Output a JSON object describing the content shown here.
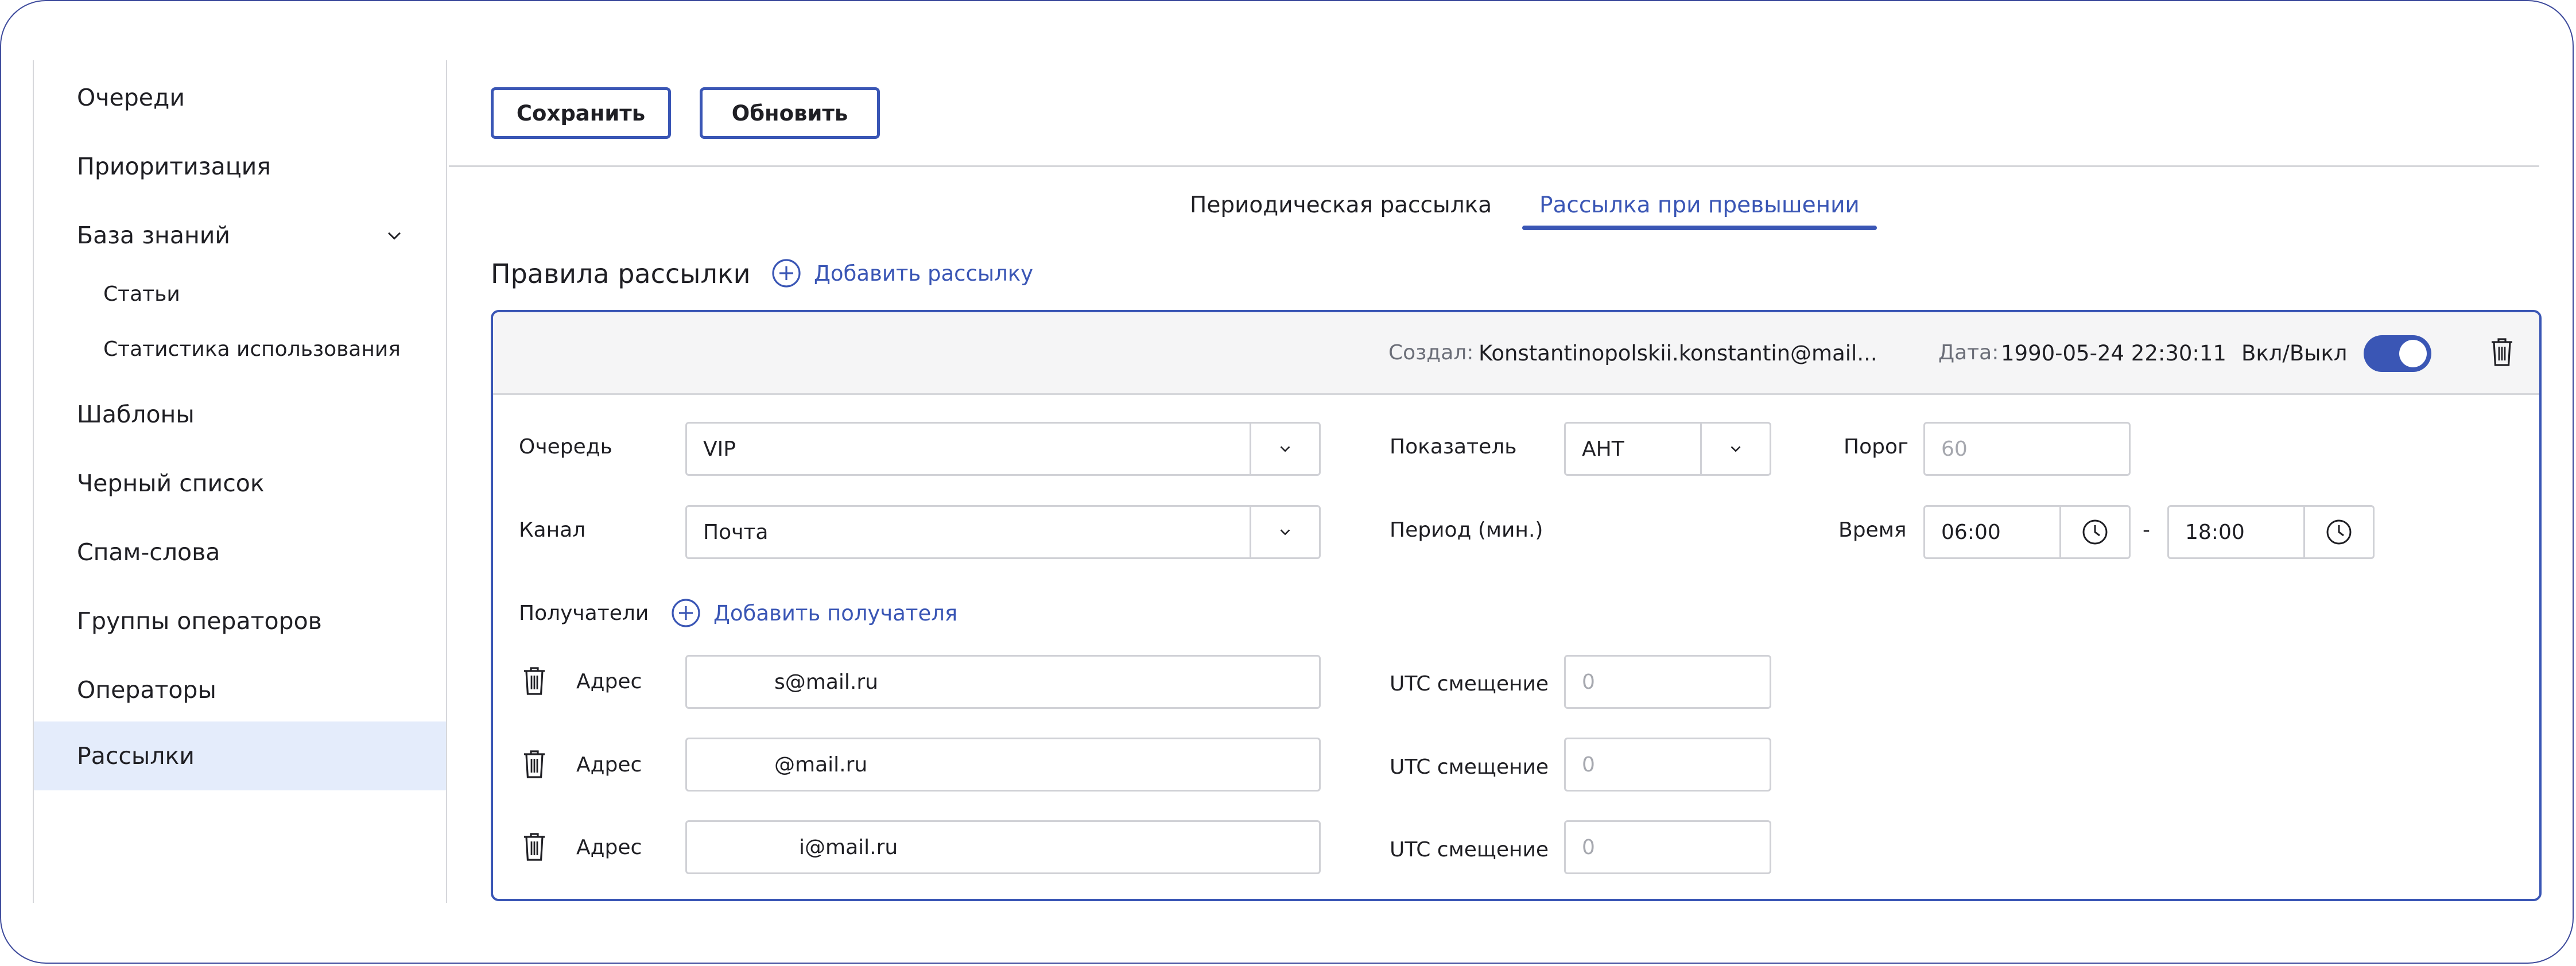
{
  "sidebar": {
    "items": [
      {
        "label": "Очереди"
      },
      {
        "label": "Приоритизация"
      },
      {
        "label": "База знаний"
      },
      {
        "label": "Статьи"
      },
      {
        "label": "Статистика использования"
      },
      {
        "label": "Шаблоны"
      },
      {
        "label": "Черный список"
      },
      {
        "label": "Спам-слова"
      },
      {
        "label": "Группы операторов"
      },
      {
        "label": "Операторы"
      },
      {
        "label": "Рассылки"
      }
    ],
    "active": "Рассылки"
  },
  "toolbar": {
    "save_label": "Сохранить",
    "refresh_label": "Обновить"
  },
  "tabs": [
    {
      "label": "Периодическая рассылка",
      "active": false
    },
    {
      "label": "Рассылка при превышении",
      "active": true
    }
  ],
  "rules": {
    "title": "Правила рассылки",
    "add_label": "Добавить рассылку"
  },
  "card": {
    "creator_label": "Создал:",
    "creator_value": "Konstantinopolskii.konstantin@mail...",
    "date_label": "Дата:",
    "date_value": "1990-05-24 22:30:11",
    "toggle_label": "Вкл/Выкл",
    "toggle_on": true,
    "queue_label": "Очередь",
    "queue_value": "VIP",
    "channel_label": "Канал",
    "channel_value": "Почта",
    "indicator_label": "Показатель",
    "indicator_value": "AHT",
    "period_label": "Период (мин.)",
    "threshold_label": "Порог",
    "threshold_placeholder": "60",
    "time_label": "Время",
    "time_from": "06:00",
    "time_sep": "-",
    "time_to": "18:00",
    "recipients_label": "Получатели",
    "add_recipient_label": "Добавить получателя",
    "address_label": "Адрес",
    "utc_label": "UTC смещение",
    "recipients": [
      {
        "address": "s@mail.ru",
        "utc_placeholder": "0"
      },
      {
        "address": "@mail.ru",
        "utc_placeholder": "0"
      },
      {
        "address": "i@mail.ru",
        "utc_placeholder": "0"
      }
    ]
  },
  "colors": {
    "accent": "#3a56b5",
    "active_bg": "#e4ecfb",
    "border": "#d0d1d6"
  }
}
